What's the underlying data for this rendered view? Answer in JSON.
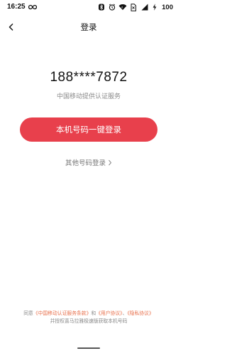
{
  "status_bar": {
    "time": "16:25",
    "battery": "100"
  },
  "header": {
    "title": "登录"
  },
  "account": {
    "masked_phone": "188****7872",
    "auth_service": "中国移动提供认证服务"
  },
  "actions": {
    "one_click_login": "本机号码一键登录",
    "other_login": "其他号码登录",
    "other_login_chevron": "〉"
  },
  "agreement": {
    "prefix": "同意",
    "link_service": "《中国移动认证服务条款》",
    "conj1": "和",
    "link_user": "《用户协议》",
    "sep": "、",
    "link_privacy": "《隐私协议》",
    "suffix": "并授权喜马拉雅极速版获取本机号码"
  },
  "colors": {
    "accent": "#e8404c",
    "link": "#e8704c"
  }
}
